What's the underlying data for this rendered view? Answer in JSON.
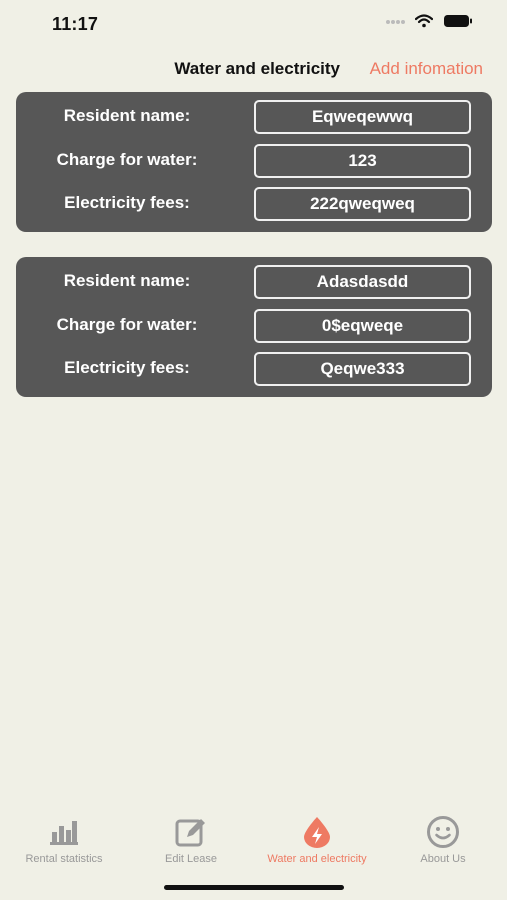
{
  "status_bar": {
    "time": "11:17"
  },
  "header": {
    "title": "Water and electricity",
    "action_label": "Add infomation"
  },
  "records": [
    {
      "resident_label": "Resident name:",
      "resident_value": "Eqweqewwq",
      "water_label": "Charge for water:",
      "water_value": "123",
      "electricity_label": "Electricity fees:",
      "electricity_value": "222qweqweq"
    },
    {
      "resident_label": "Resident name:",
      "resident_value": "Adasdasdd",
      "water_label": "Charge for water:",
      "water_value": "0$eqweqe",
      "electricity_label": "Electricity fees:",
      "electricity_value": "Qeqwe333"
    }
  ],
  "tab_bar": {
    "tabs": [
      {
        "label": "Rental statistics",
        "icon": "bar-chart-icon"
      },
      {
        "label": "Edit Lease",
        "icon": "edit-icon"
      },
      {
        "label": "Water and electricity",
        "icon": "water-electricity-icon",
        "active": true
      },
      {
        "label": "About Us",
        "icon": "smiley-icon"
      }
    ]
  },
  "colors": {
    "background": "#f0f0e6",
    "card": "#575757",
    "accent": "#ee7a63",
    "tab_inactive": "#999999"
  }
}
